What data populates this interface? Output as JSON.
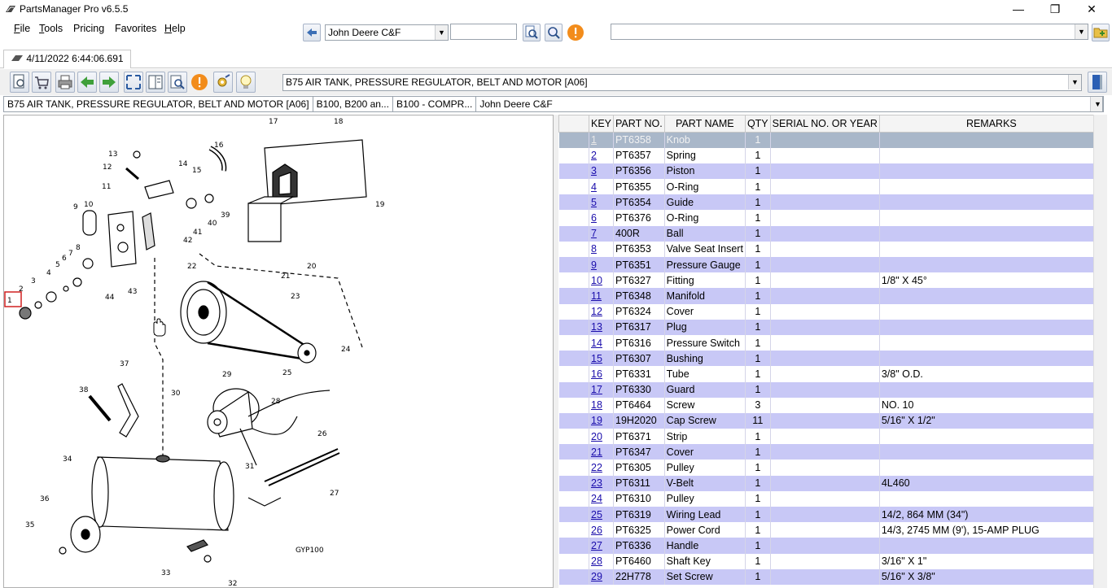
{
  "window": {
    "title": "PartsManager Pro v6.5.5",
    "minimize_glyph": "—",
    "maximize_glyph": "❐",
    "close_glyph": "✕"
  },
  "menu": {
    "file": "File",
    "tools": "Tools",
    "pricing": "Pricing",
    "favorites": "Favorites",
    "help": "Help"
  },
  "topbar": {
    "catalog_select": "John Deere C&F",
    "search_value": "",
    "right_combo_value": ""
  },
  "tab": {
    "label": "4/11/2022 6:44:06.691"
  },
  "section_select": "B75 AIR TANK, PRESSURE REGULATOR, BELT AND MOTOR [A06]",
  "breadcrumb": [
    "B75 AIR TANK, PRESSURE REGULATOR, BELT AND MOTOR [A06]",
    "B100, B200 an...",
    "B100 - COMPR...",
    "John Deere C&F"
  ],
  "diagram": {
    "code": "GYP100",
    "callouts": [
      "1",
      "2",
      "3",
      "4",
      "5",
      "6",
      "7",
      "8",
      "9",
      "10",
      "11",
      "12",
      "13",
      "14",
      "15",
      "16",
      "17",
      "18",
      "19",
      "20",
      "21",
      "22",
      "23",
      "24",
      "25",
      "26",
      "27",
      "28",
      "29",
      "30",
      "31",
      "32",
      "33",
      "34",
      "35",
      "36",
      "37",
      "38",
      "39",
      "40",
      "41",
      "42",
      "43",
      "44"
    ]
  },
  "table": {
    "headers": {
      "key": "KEY",
      "part_no": "PART NO.",
      "part_name": "PART NAME",
      "qty": "QTY",
      "serial": "SERIAL NO. OR YEAR",
      "remarks": "REMARKS"
    },
    "rows": [
      {
        "key": "1",
        "part_no": "PT6358",
        "name": "Knob",
        "qty": "1",
        "serial": "",
        "remarks": ""
      },
      {
        "key": "2",
        "part_no": "PT6357",
        "name": "Spring",
        "qty": "1",
        "serial": "",
        "remarks": ""
      },
      {
        "key": "3",
        "part_no": "PT6356",
        "name": "Piston",
        "qty": "1",
        "serial": "",
        "remarks": ""
      },
      {
        "key": "4",
        "part_no": "PT6355",
        "name": "O-Ring",
        "qty": "1",
        "serial": "",
        "remarks": ""
      },
      {
        "key": "5",
        "part_no": "PT6354",
        "name": "Guide",
        "qty": "1",
        "serial": "",
        "remarks": ""
      },
      {
        "key": "6",
        "part_no": "PT6376",
        "name": "O-Ring",
        "qty": "1",
        "serial": "",
        "remarks": ""
      },
      {
        "key": "7",
        "part_no": "400R",
        "name": "Ball",
        "qty": "1",
        "serial": "",
        "remarks": ""
      },
      {
        "key": "8",
        "part_no": "PT6353",
        "name": "Valve Seat Insert",
        "qty": "1",
        "serial": "",
        "remarks": ""
      },
      {
        "key": "9",
        "part_no": "PT6351",
        "name": "Pressure Gauge",
        "qty": "1",
        "serial": "",
        "remarks": ""
      },
      {
        "key": "10",
        "part_no": "PT6327",
        "name": "Fitting",
        "qty": "1",
        "serial": "",
        "remarks": "1/8\" X 45°"
      },
      {
        "key": "11",
        "part_no": "PT6348",
        "name": "Manifold",
        "qty": "1",
        "serial": "",
        "remarks": ""
      },
      {
        "key": "12",
        "part_no": "PT6324",
        "name": "Cover",
        "qty": "1",
        "serial": "",
        "remarks": ""
      },
      {
        "key": "13",
        "part_no": "PT6317",
        "name": "Plug",
        "qty": "1",
        "serial": "",
        "remarks": ""
      },
      {
        "key": "14",
        "part_no": "PT6316",
        "name": "Pressure Switch",
        "qty": "1",
        "serial": "",
        "remarks": ""
      },
      {
        "key": "15",
        "part_no": "PT6307",
        "name": "Bushing",
        "qty": "1",
        "serial": "",
        "remarks": ""
      },
      {
        "key": "16",
        "part_no": "PT6331",
        "name": "Tube",
        "qty": "1",
        "serial": "",
        "remarks": "3/8\" O.D."
      },
      {
        "key": "17",
        "part_no": "PT6330",
        "name": "Guard",
        "qty": "1",
        "serial": "",
        "remarks": ""
      },
      {
        "key": "18",
        "part_no": "PT6464",
        "name": "Screw",
        "qty": "3",
        "serial": "",
        "remarks": "NO. 10"
      },
      {
        "key": "19",
        "part_no": "19H2020",
        "name": "Cap Screw",
        "qty": "11",
        "serial": "",
        "remarks": "5/16\" X 1/2\""
      },
      {
        "key": "20",
        "part_no": "PT6371",
        "name": "Strip",
        "qty": "1",
        "serial": "",
        "remarks": ""
      },
      {
        "key": "21",
        "part_no": "PT6347",
        "name": "Cover",
        "qty": "1",
        "serial": "",
        "remarks": ""
      },
      {
        "key": "22",
        "part_no": "PT6305",
        "name": "Pulley",
        "qty": "1",
        "serial": "",
        "remarks": ""
      },
      {
        "key": "23",
        "part_no": "PT6311",
        "name": "V-Belt",
        "qty": "1",
        "serial": "",
        "remarks": "4L460"
      },
      {
        "key": "24",
        "part_no": "PT6310",
        "name": "Pulley",
        "qty": "1",
        "serial": "",
        "remarks": ""
      },
      {
        "key": "25",
        "part_no": "PT6319",
        "name": "Wiring Lead",
        "qty": "1",
        "serial": "",
        "remarks": "14/2, 864 MM (34\")"
      },
      {
        "key": "26",
        "part_no": "PT6325",
        "name": "Power Cord",
        "qty": "1",
        "serial": "",
        "remarks": "14/3, 2745 MM (9'), 15-AMP PLUG"
      },
      {
        "key": "27",
        "part_no": "PT6336",
        "name": "Handle",
        "qty": "1",
        "serial": "",
        "remarks": ""
      },
      {
        "key": "28",
        "part_no": "PT6460",
        "name": "Shaft Key",
        "qty": "1",
        "serial": "",
        "remarks": "3/16\" X 1\""
      },
      {
        "key": "29",
        "part_no": "22H778",
        "name": "Set Screw",
        "qty": "1",
        "serial": "",
        "remarks": "5/16\" X 3/8\""
      }
    ]
  },
  "colors": {
    "row_even": "#c8c8f6",
    "row_selected": "#a9b7c9",
    "link": "#1a0dab",
    "orange_btn": "#f28c1b",
    "green_arrow": "#3fa03a"
  }
}
